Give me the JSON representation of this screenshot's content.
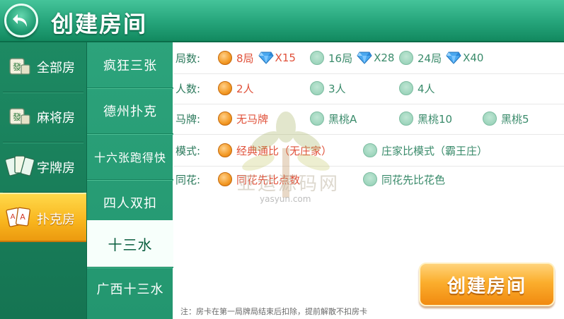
{
  "header": {
    "title": "创建房间"
  },
  "categories": [
    {
      "label": "全部房",
      "icon": "mahjong-tile-icon"
    },
    {
      "label": "麻将房",
      "icon": "mahjong-tile-icon"
    },
    {
      "label": "字牌房",
      "icon": "word-cards-icon"
    },
    {
      "label": "扑克房",
      "icon": "poker-cards-icon",
      "active": true
    }
  ],
  "games": [
    {
      "label": "疯狂三张"
    },
    {
      "label": "德州扑克"
    },
    {
      "label": "十六张跑得快"
    },
    {
      "label": "四人双扣"
    },
    {
      "label": "十三水",
      "active": true
    },
    {
      "label": "广西十三水"
    }
  ],
  "options": {
    "rounds": {
      "label": "局数:",
      "choices": [
        {
          "text": "8局",
          "cost": "X15",
          "selected": true
        },
        {
          "text": "16局",
          "cost": "X28",
          "selected": false
        },
        {
          "text": "24局",
          "cost": "X40",
          "selected": false
        }
      ]
    },
    "players": {
      "label": "人数:",
      "choices": [
        {
          "text": "2人",
          "selected": true
        },
        {
          "text": "3人",
          "selected": false
        },
        {
          "text": "4人",
          "selected": false
        }
      ]
    },
    "horse": {
      "label": "马牌:",
      "choices": [
        {
          "text": "无马牌",
          "selected": true
        },
        {
          "text": "黑桃A",
          "selected": false
        },
        {
          "text": "黑桃10",
          "selected": false
        },
        {
          "text": "黑桃5",
          "selected": false
        }
      ]
    },
    "mode": {
      "label": "模式:",
      "choices": [
        {
          "text": "经典通比（无庄家）",
          "selected": true
        },
        {
          "text": "庄家比模式（霸王庄）",
          "selected": false
        }
      ]
    },
    "flush": {
      "label": "同花:",
      "choices": [
        {
          "text": "同花先比点数",
          "selected": true
        },
        {
          "text": "同花先比花色",
          "selected": false
        }
      ]
    }
  },
  "create_button": {
    "label": "创建房间"
  },
  "note": "注：房卡在第一局牌局结束后扣除，提前解散不扣房卡",
  "watermark": {
    "text": "亚运源码网",
    "domain": "yasyun.com"
  },
  "colors": {
    "accent_green": "#25a47a",
    "selected_orange": "#f39a26",
    "selected_text": "#e0513a",
    "button_orange": "#fbae2d"
  }
}
